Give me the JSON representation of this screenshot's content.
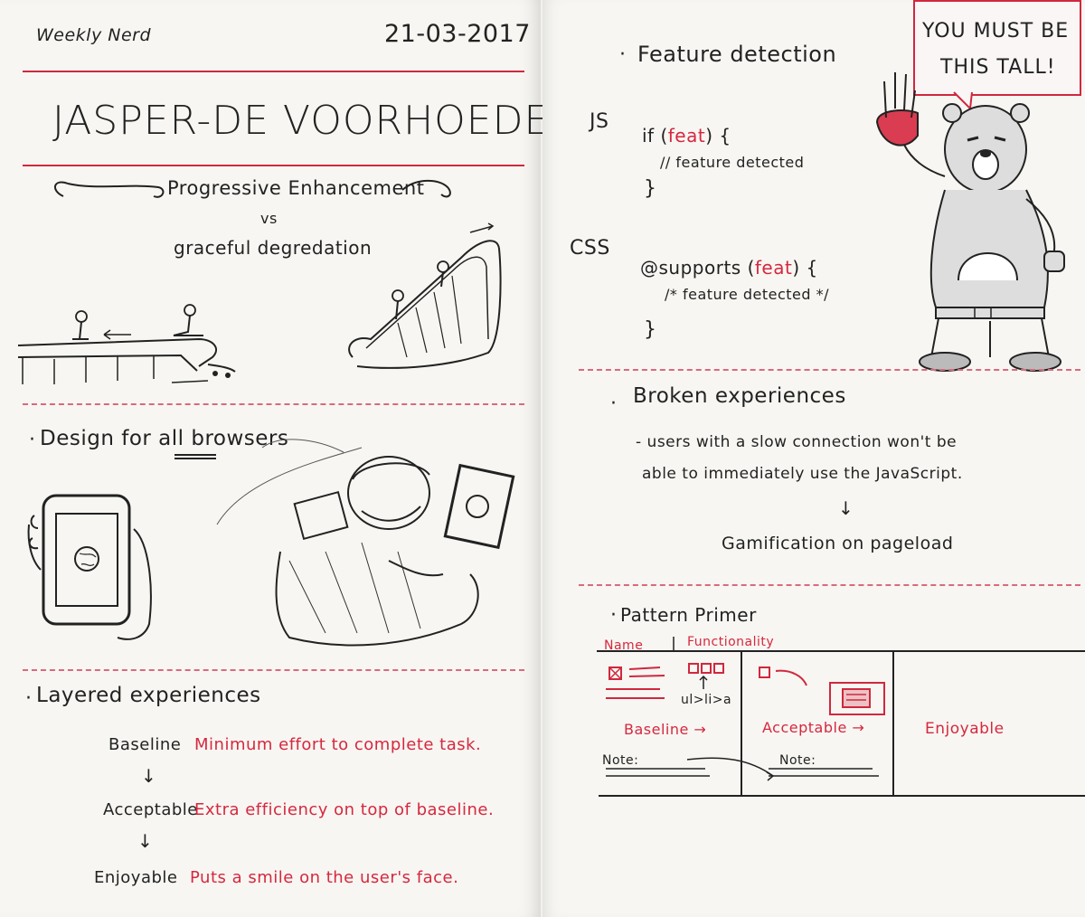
{
  "left": {
    "header": {
      "label": "Weekly Nerd",
      "date": "21-03-2017"
    },
    "speaker": "JASPER-DE VOORHOEDE",
    "topic1": {
      "title": "Progressive Enhancement",
      "vs": "vs",
      "subtitle": "graceful degredation"
    },
    "topic2": {
      "title": "Design for all browsers",
      "emphasis_word": "all"
    },
    "topic3": {
      "title": "Layered experiences",
      "levels": [
        {
          "name": "Baseline",
          "desc": "Minimum effort to complete task."
        },
        {
          "name": "Acceptable",
          "desc": "Extra efficiency on top of baseline."
        },
        {
          "name": "Enjoyable",
          "desc": "Puts a smile on the user's face."
        }
      ],
      "arrow": "↓"
    }
  },
  "right": {
    "feature": {
      "title": "Feature detection",
      "js_label": "JS",
      "js_code": [
        "if (feat) {",
        "// feature detected",
        "}"
      ],
      "css_label": "CSS",
      "css_code": [
        "@supports (feat) {",
        "/* feature detected */",
        "}"
      ],
      "feat_keyword": "feat"
    },
    "bear_sign": [
      "YOU MUST BE",
      "THIS TALL!"
    ],
    "broken": {
      "title": "Broken experiences",
      "text": [
        "- users with a slow connection won't be",
        "able to immediately use the JavaScript."
      ],
      "arrow": "↓",
      "result": "Gamification on pageload"
    },
    "pattern": {
      "title": "Pattern Primer",
      "headers": [
        "Name",
        "Functionality"
      ],
      "list_label": "ul>li>a",
      "labels": [
        "Baseline →",
        "Acceptable →",
        "Enjoyable"
      ],
      "note_label": "Note:"
    }
  },
  "colors": {
    "accent": "#d6283f",
    "ink": "#222222",
    "paper": "#f7f6f2"
  }
}
